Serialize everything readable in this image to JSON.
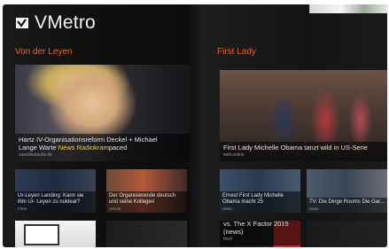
{
  "app": {
    "title": "VMetro",
    "logo_icon": "vmetro-logo-icon"
  },
  "sections": [
    {
      "title": "Von der Leyen",
      "featured": {
        "caption_main": "Hartz IV-Organisationsreform Deckel + Michael",
        "caption_line2_pre": "Lange Warte ",
        "caption_ticker": "News Radiokram",
        "caption_line2_post": "paced",
        "source": "sueddeutsche.de"
      },
      "tiles": [
        {
          "caption": "Ur-Leyen Landing: Kann sie ihm Ur- Leyen zu nuklear?",
          "source": "t-free"
        },
        {
          "caption": "Der Organisierende deutsch und seine Kollegen",
          "source": "zeit.de"
        }
      ]
    },
    {
      "title": "First Lady",
      "featured": {
        "caption_main": "First Lady Michelle Obama tanzt wild in US-Serie",
        "source": "welt.online"
      },
      "tiles": [
        {
          "caption": "Ernest First Lady Michelle Obama macht 25",
          "source": "news"
        },
        {
          "caption": "TV: Die Dinge Rooms\nDie Gar...",
          "source": "news"
        }
      ],
      "bottom_caption": "vs. The X Factor 2015 (news)",
      "bottom_source": "feed"
    }
  ],
  "colors": {
    "accent": "#e8622c",
    "ticker": "#f0d145",
    "background": "#111111"
  }
}
